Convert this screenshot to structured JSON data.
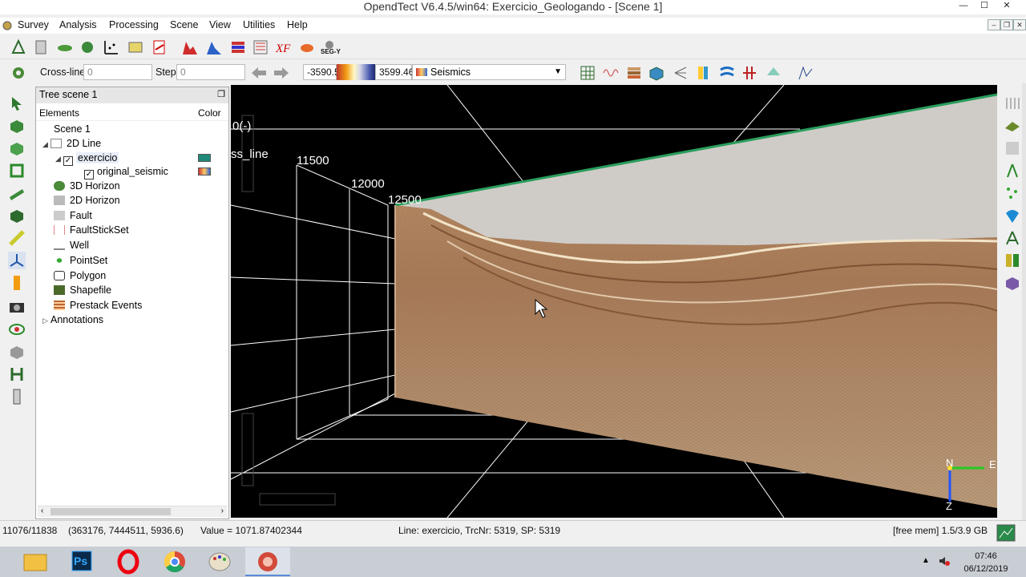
{
  "window": {
    "title": "OpendTect V6.4.5/win64: Exercicio_Geologando - [Scene 1]"
  },
  "menus": [
    "Survey",
    "Analysis",
    "Processing",
    "Scene",
    "View",
    "Utilities",
    "Help"
  ],
  "toolbar1": {
    "icons": [
      "survey-setup-icon",
      "data-manager-icon",
      "import-horizon-icon",
      "export-icon",
      "crossplot-icon",
      "pdf-icon",
      "volume-builder-icon",
      "spectrum-icon",
      "velocity-icon",
      "attribute-icon",
      "xfield-icon",
      "freeflow-icon",
      "segy-icon"
    ],
    "segy_label": "SEG-Y"
  },
  "slice_nav": {
    "crossline_label": "Cross-line",
    "crossline_value": "0",
    "step_label": "Step",
    "step_value": "0"
  },
  "colorbar": {
    "min": "-3590.5",
    "max": "3599.46",
    "colortable": "Seismics"
  },
  "tree": {
    "title": "Tree scene 1",
    "col_elements": "Elements",
    "col_color": "Color",
    "items": [
      {
        "label": "Scene 1"
      },
      {
        "label": "2D Line"
      },
      {
        "label": "exercicio"
      },
      {
        "label": "original_seismic"
      },
      {
        "label": "3D Horizon"
      },
      {
        "label": "2D Horizon"
      },
      {
        "label": "Fault"
      },
      {
        "label": "FaultStickSet"
      },
      {
        "label": "Well"
      },
      {
        "label": "PointSet"
      },
      {
        "label": "Polygon"
      },
      {
        "label": "Shapefile"
      },
      {
        "label": "Prestack Events"
      },
      {
        "label": "Annotations"
      }
    ]
  },
  "viewer": {
    "annotations": [
      "0(-)",
      "ss_line",
      "11500",
      "12000",
      "12500"
    ],
    "compass": {
      "north": "N",
      "east": "E",
      "z": "Z"
    },
    "colors": {
      "line_outline": "#2a9d5c",
      "grid": "#ffffff",
      "background": "#000000"
    }
  },
  "status": {
    "position": "11076/11838",
    "coords": "(363176, 7444511, 5936.6)",
    "value": "Value = 1071.87402344",
    "line_info": "Line: exercicio, TrcNr: 5319, SP: 5319",
    "mem": "[free mem] 1.5/3.9 GB"
  },
  "taskbar": {
    "apps": [
      "file-explorer-icon",
      "photoshop-icon",
      "opera-icon",
      "chrome-icon",
      "paint-icon",
      "opendtect-icon"
    ],
    "ps_label": "Ps",
    "time": "07:46",
    "date": "06/12/2019"
  }
}
